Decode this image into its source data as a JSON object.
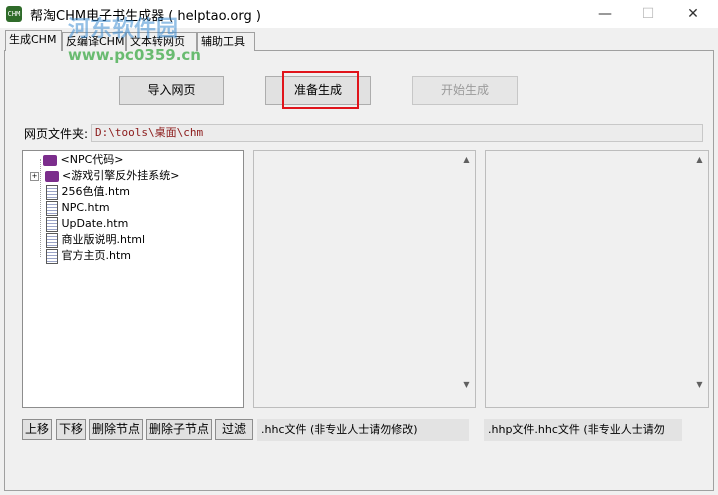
{
  "window": {
    "title": "帮淘CHM电子书生成器 ( helptao.org )",
    "icon_text": "CHM",
    "minimize": "—",
    "maximize": "☐",
    "close": "✕"
  },
  "tabs": [
    {
      "label": "生成CHM"
    },
    {
      "label": "反编译CHM"
    },
    {
      "label": "文本转网页"
    },
    {
      "label": "辅助工具"
    }
  ],
  "watermark": {
    "line1": "河东软件园",
    "line2": "www.pc0359.cn"
  },
  "buttons": {
    "import": "导入网页",
    "prepare": "准备生成",
    "start": "开始生成"
  },
  "folder": {
    "label": "网页文件夹:",
    "path": "D:\\tools\\桌面\\chm"
  },
  "tree": [
    {
      "label": "<NPC代码>",
      "type": "book"
    },
    {
      "label": "<游戏引擎反外挂系统>",
      "type": "book",
      "expandable": true
    },
    {
      "label": "256色值.htm",
      "type": "file"
    },
    {
      "label": "NPC.htm",
      "type": "file"
    },
    {
      "label": "UpDate.htm",
      "type": "file"
    },
    {
      "label": "商业版说明.html",
      "type": "file"
    },
    {
      "label": "官方主页.htm",
      "type": "file"
    }
  ],
  "bottom_buttons": {
    "up": "上移",
    "down": "下移",
    "delete_node": "删除节点",
    "delete_child": "删除子节点",
    "filter": "过滤"
  },
  "status": {
    "hhc": ".hhc文件 (非专业人士请勿修改)",
    "hhp": ".hhp文件.hhc文件 (非专业人士请勿"
  },
  "icons": {
    "scroll_up": "▲",
    "scroll_down": "▼",
    "expand": "+"
  }
}
